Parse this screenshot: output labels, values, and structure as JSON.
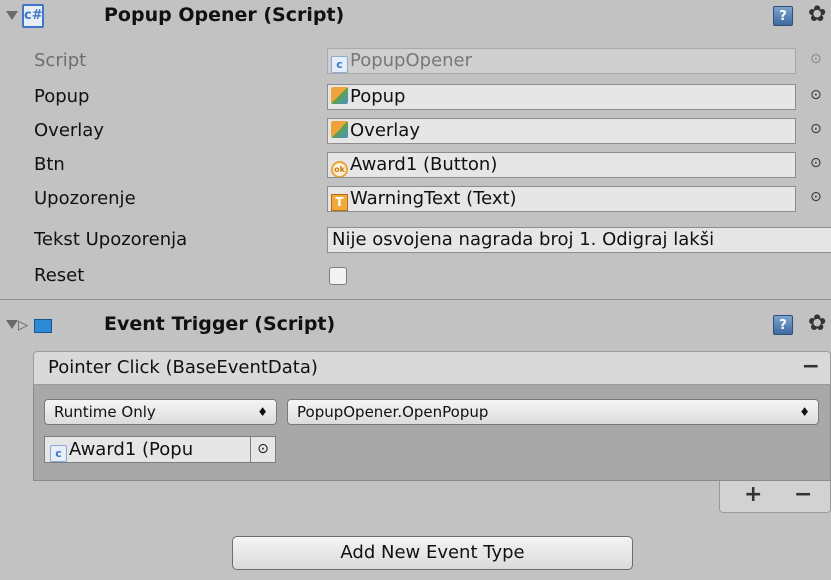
{
  "popup_opener": {
    "title": "Popup Opener (Script)",
    "help_glyph": "?",
    "gear_glyph": "✿",
    "properties": [
      {
        "label": "Script",
        "value": "PopupOpener",
        "icon": "script-icon",
        "disabled": true
      },
      {
        "label": "Popup",
        "value": "Popup",
        "icon": "cube-icon"
      },
      {
        "label": "Overlay",
        "value": "Overlay",
        "icon": "cube-icon"
      },
      {
        "label": "Btn",
        "value": "Award1 (Button)",
        "icon": "button-icon"
      },
      {
        "label": "Upozorenje",
        "value": "WarningText (Text)",
        "icon": "text-icon"
      },
      {
        "label": "Tekst Upozorenja",
        "value": "Nije osvojena nagrada broj 1. Odigraj lakši"
      },
      {
        "label": "Reset",
        "checked": false
      }
    ]
  },
  "event_trigger": {
    "title": "Event Trigger (Script)",
    "help_glyph": "?",
    "gear_glyph": "✿",
    "entry": {
      "label": "Pointer Click (BaseEventData)",
      "remove_glyph": "−",
      "runtime_option": "Runtime Only",
      "function": "PopupOpener.OpenPopup",
      "target": "Award1 (Popu",
      "dropdown_glyph": "♦"
    },
    "add_glyph": "+",
    "remove_glyph": "−",
    "add_button_label": "Add New Event Type"
  },
  "glyphs": {
    "picker": "⊙"
  },
  "colors": {
    "panel_bg": "#c2c2c2",
    "field_bg": "#e6e6e6",
    "event_body_bg": "#a8a8a8"
  }
}
